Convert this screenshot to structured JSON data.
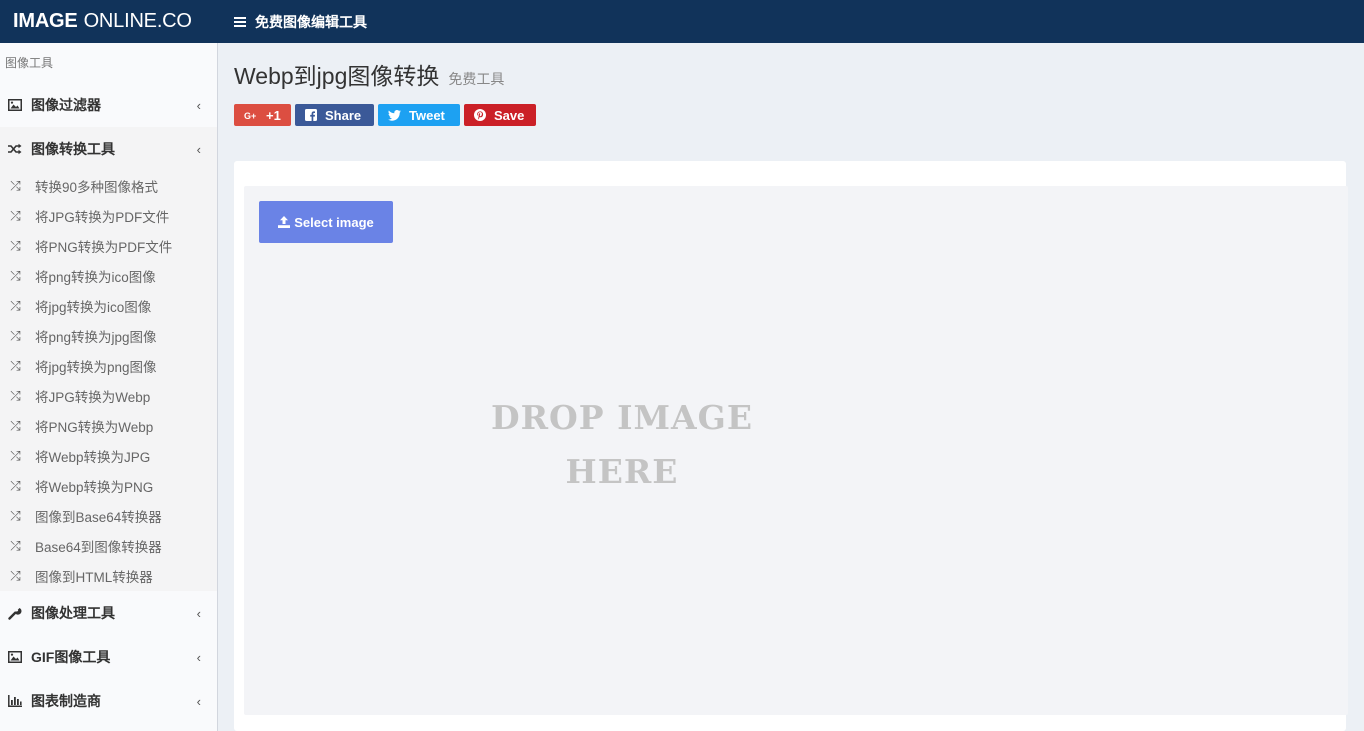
{
  "header": {
    "logo_bold": "IMAGE",
    "logo_rest": "ONLINE.CO",
    "menu_label": "免费图像编辑工具"
  },
  "sidebar": {
    "section_label": "图像工具",
    "groups": [
      {
        "label": "图像过滤器",
        "icon": "image-icon"
      },
      {
        "label": "图像转换工具",
        "icon": "shuffle-icon"
      },
      {
        "label": "图像处理工具",
        "icon": "wrench-icon"
      },
      {
        "label": "GIF图像工具",
        "icon": "image-icon"
      },
      {
        "label": "图表制造商",
        "icon": "bar-chart-icon"
      }
    ],
    "conversion_items": [
      "转换90多种图像格式",
      "将JPG转换为PDF文件",
      "将PNG转换为PDF文件",
      "将png转换为ico图像",
      "将jpg转换为ico图像",
      "将png转换为jpg图像",
      "将jpg转换为png图像",
      "将JPG转换为Webp",
      "将PNG转换为Webp",
      "将Webp转换为JPG",
      "将Webp转换为PNG",
      "图像到Base64转换器",
      "Base64到图像转换器",
      "图像到HTML转换器"
    ]
  },
  "main": {
    "title": "Webp到jpg图像转换",
    "subtitle": "免费工具",
    "share": {
      "gplus": "+1",
      "facebook": "Share",
      "twitter": "Tweet",
      "pinterest": "Save"
    },
    "select_button": "Select image",
    "drop_line1": "DROP IMAGE",
    "drop_line2": "HERE"
  },
  "colors": {
    "header_bg": "#11335a",
    "gplus": "#dc4e41",
    "facebook": "#3b5998",
    "twitter": "#1da1f2",
    "pinterest": "#cb2027",
    "select_button": "#6a83e6"
  }
}
